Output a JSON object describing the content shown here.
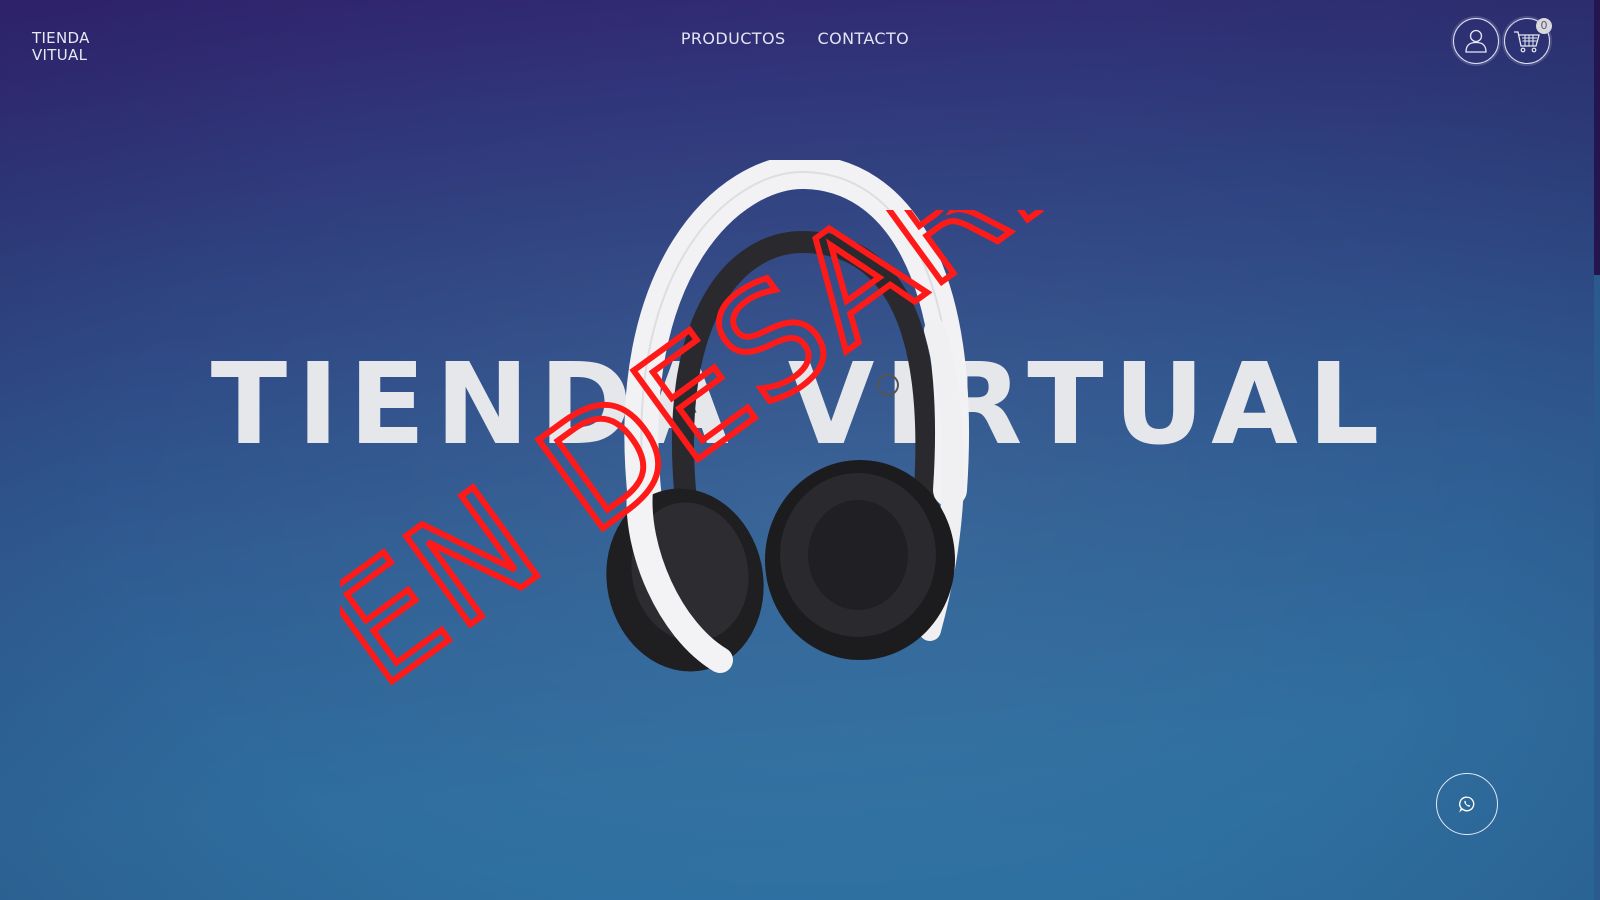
{
  "header": {
    "brand_line1": "TIENDA",
    "brand_line2": "VITUAL",
    "nav": [
      {
        "label": "PRODUCTOS"
      },
      {
        "label": "CONTACTO"
      }
    ],
    "account_icon": "user-icon",
    "cart_icon": "shopping-cart-icon",
    "cart_count": "0"
  },
  "hero": {
    "title": "TIENDA VIRTUAL",
    "product_image": "white-black-wireless-headset",
    "overlay_stamp": "EN DESARROLLO",
    "overlay_color": "#ff1a1a"
  },
  "floating": {
    "whatsapp_icon": "whatsapp-icon"
  },
  "colors": {
    "gradient_top": "#332673",
    "gradient_bottom": "#2e72a2",
    "text": "#e6e7ea"
  }
}
